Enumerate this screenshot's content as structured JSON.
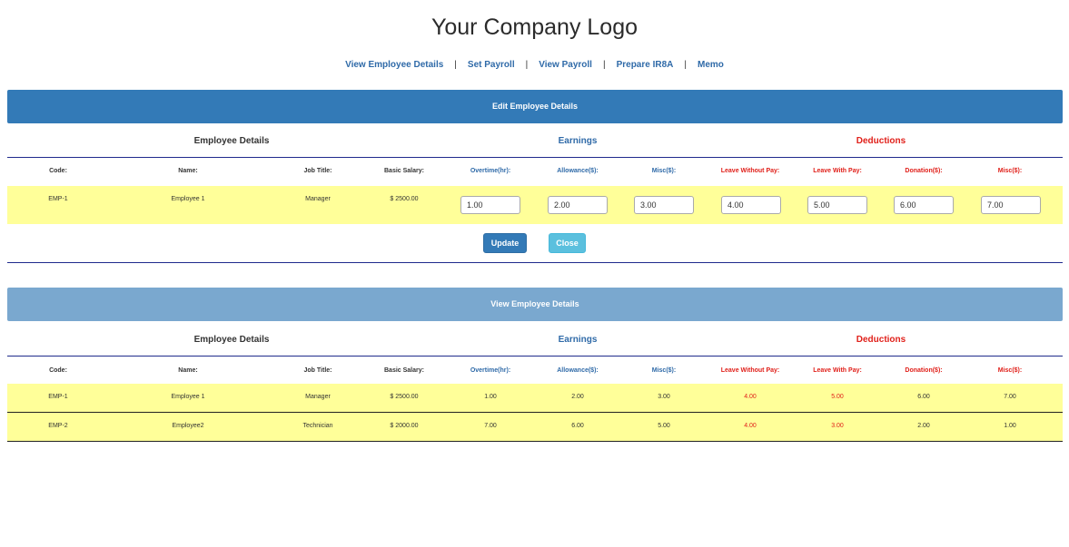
{
  "logo": "Your Company Logo",
  "nav": [
    "View Employee Details",
    "Set Payroll",
    "View Payroll",
    "Prepare IR8A",
    "Memo"
  ],
  "nav_sep": "|",
  "edit_panel": {
    "title": "Edit Employee Details",
    "groups": {
      "employee": "Employee Details",
      "earnings": "Earnings",
      "deductions": "Deductions"
    },
    "headers": [
      "Code:",
      "Name:",
      "Job Title:",
      "Basic Salary:",
      "Overtime(hr):",
      "Allowance($):",
      "Misc($):",
      "Leave Without Pay:",
      "Leave With Pay:",
      "Donation($):",
      "Misc($):"
    ],
    "row": {
      "code": "EMP-1",
      "name": "Employee 1",
      "job": "Manager",
      "salary": "$ 2500.00",
      "inputs": [
        "1.00",
        "2.00",
        "3.00",
        "4.00",
        "5.00",
        "6.00",
        "7.00"
      ]
    },
    "update_label": "Update",
    "close_label": "Close"
  },
  "view_panel": {
    "title": "View Employee Details",
    "groups": {
      "employee": "Employee Details",
      "earnings": "Earnings",
      "deductions": "Deductions"
    },
    "headers": [
      "Code:",
      "Name:",
      "Job Title:",
      "Basic Salary:",
      "Overtime(hr):",
      "Allowance($):",
      "Misc($):",
      "Leave Without Pay:",
      "Leave With Pay:",
      "Donation($):",
      "Misc($):"
    ],
    "rows": [
      [
        "EMP-1",
        "Employee 1",
        "Manager",
        "$ 2500.00",
        "1.00",
        "2.00",
        "3.00",
        "4.00",
        "5.00",
        "6.00",
        "7.00"
      ],
      [
        "EMP-2",
        "Employee2",
        "Technician",
        "$ 2000.00",
        "7.00",
        "6.00",
        "5.00",
        "4.00",
        "3.00",
        "2.00",
        "1.00"
      ]
    ]
  },
  "colors": {
    "primary": "#337ab7",
    "header_light": "#7aa8cf",
    "row_highlight": "#ffff99",
    "deduction_red": "#e0201a",
    "earnings_blue": "#2f6aa8",
    "info_button": "#5bc0de"
  }
}
